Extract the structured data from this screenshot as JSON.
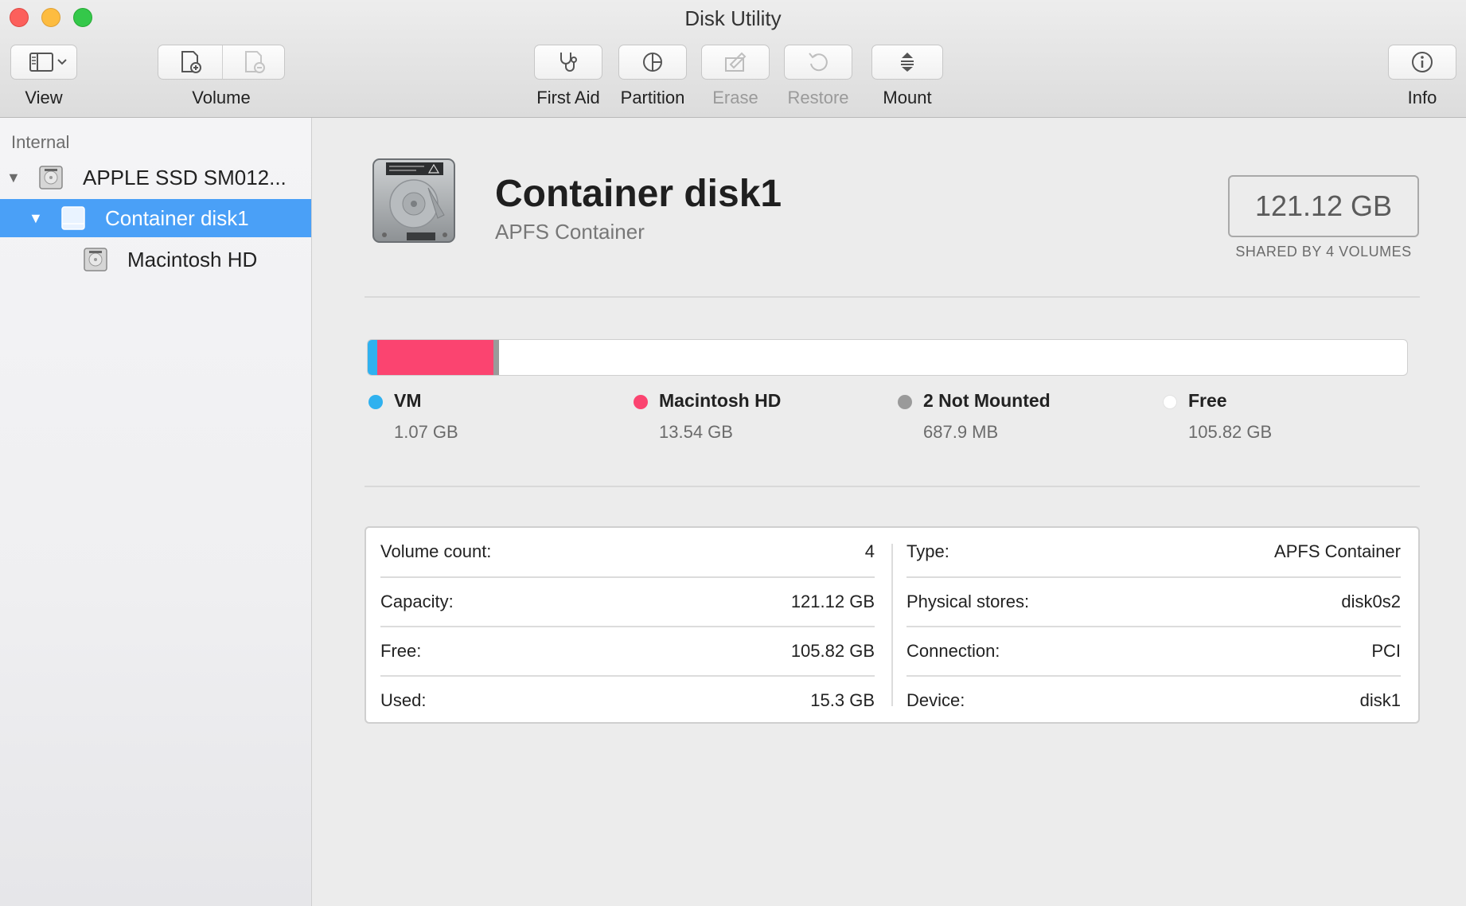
{
  "window": {
    "title": "Disk Utility"
  },
  "toolbar": {
    "view_label": "View",
    "volume_label": "Volume",
    "first_aid_label": "First Aid",
    "partition_label": "Partition",
    "erase_label": "Erase",
    "restore_label": "Restore",
    "mount_label": "Mount",
    "info_label": "Info"
  },
  "sidebar": {
    "section": "Internal",
    "items": [
      {
        "label": "APPLE SSD SM012...",
        "icon": "internal-drive-icon"
      },
      {
        "label": "Container disk1",
        "icon": "container-icon",
        "selected": true
      },
      {
        "label": "Macintosh HD",
        "icon": "volume-drive-icon"
      }
    ]
  },
  "header": {
    "title": "Container disk1",
    "subtitle": "APFS Container",
    "capacity": "121.12 GB",
    "shared": "SHARED BY 4 VOLUMES"
  },
  "usage": {
    "total_gb": 121.12,
    "segments": [
      {
        "name": "VM",
        "value": "1.07 GB",
        "gb": 1.07,
        "color": "#2fb1ef"
      },
      {
        "name": "Macintosh HD",
        "value": "13.54 GB",
        "gb": 13.54,
        "color": "#fb4470"
      },
      {
        "name": "2 Not Mounted",
        "value": "687.9 MB",
        "gb": 0.6879,
        "color": "#9a9a9a"
      },
      {
        "name": "Free",
        "value": "105.82 GB",
        "gb": 105.82,
        "color": "#ffffff"
      }
    ]
  },
  "details": {
    "left": [
      {
        "label": "Volume count:",
        "value": "4"
      },
      {
        "label": "Capacity:",
        "value": "121.12 GB"
      },
      {
        "label": "Free:",
        "value": "105.82 GB"
      },
      {
        "label": "Used:",
        "value": "15.3 GB"
      }
    ],
    "right": [
      {
        "label": "Type:",
        "value": "APFS Container"
      },
      {
        "label": "Physical stores:",
        "value": "disk0s2"
      },
      {
        "label": "Connection:",
        "value": "PCI"
      },
      {
        "label": "Device:",
        "value": "disk1"
      }
    ]
  }
}
